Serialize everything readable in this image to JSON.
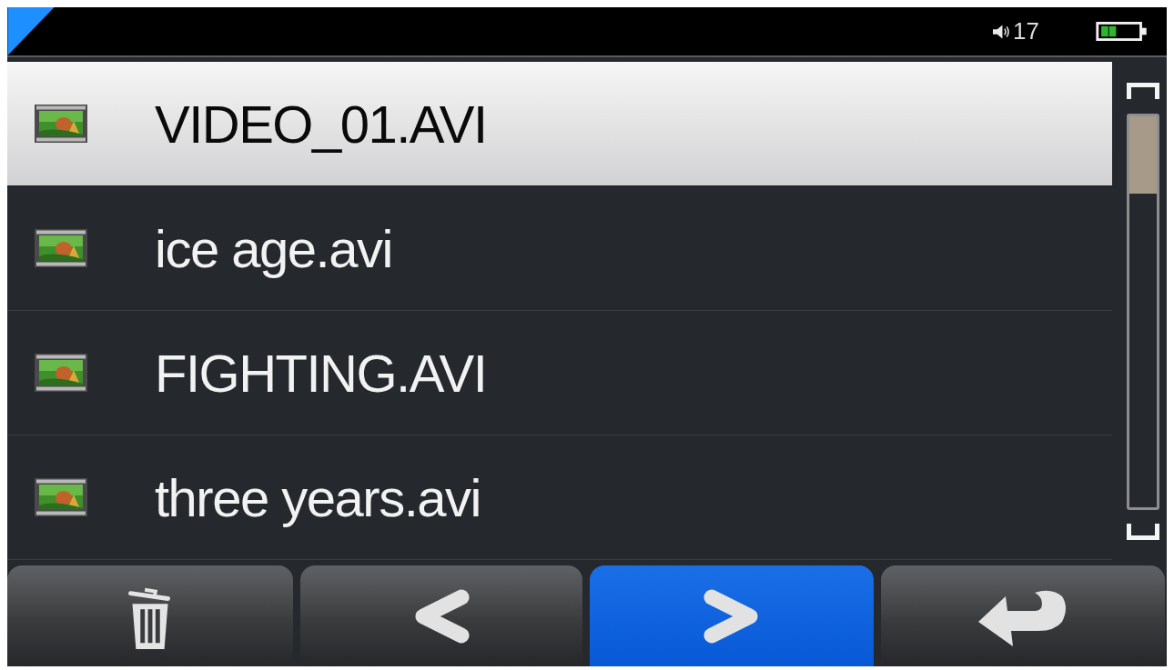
{
  "status_bar": {
    "volume": "17"
  },
  "files": [
    {
      "name": "VIDEO_01.AVI",
      "selected": true
    },
    {
      "name": "ice age.avi",
      "selected": false
    },
    {
      "name": "FIGHTING.AVI",
      "selected": false
    },
    {
      "name": "three years.avi",
      "selected": false
    }
  ],
  "toolbar": [
    {
      "kind": "delete",
      "selected": false
    },
    {
      "kind": "previous",
      "selected": false
    },
    {
      "kind": "next",
      "selected": true
    },
    {
      "kind": "back",
      "selected": false
    }
  ]
}
